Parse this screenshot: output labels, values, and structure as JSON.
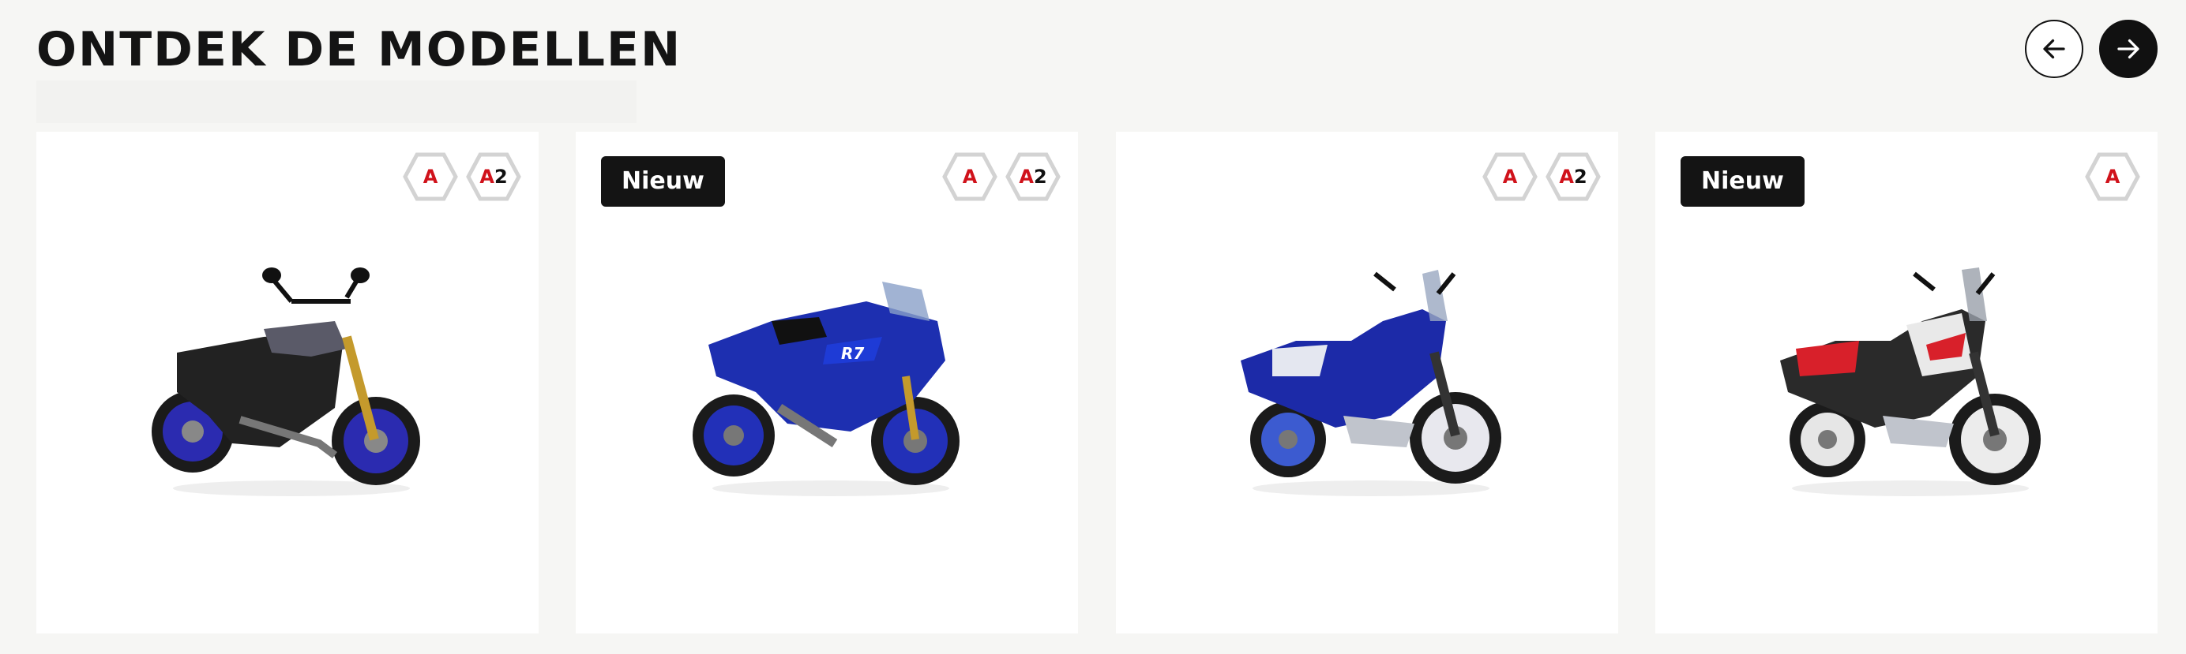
{
  "header": {
    "title": "ONTDEK DE MODELLEN",
    "prev_icon": "arrow-left-icon",
    "next_icon": "arrow-right-icon"
  },
  "colors": {
    "background": "#f6f6f4",
    "card": "#ffffff",
    "badge": "#141414",
    "license_red": "#d0121b",
    "hex_border": "#d3d3d3"
  },
  "cards": [
    {
      "badge": "",
      "licenses": [
        {
          "letter": "A",
          "suffix": ""
        },
        {
          "letter": "A",
          "suffix": "2"
        }
      ],
      "image": "motorcycle-naked-blue-black"
    },
    {
      "badge": "Nieuw",
      "licenses": [
        {
          "letter": "A",
          "suffix": ""
        },
        {
          "letter": "A",
          "suffix": "2"
        }
      ],
      "image": "motorcycle-sport-blue"
    },
    {
      "badge": "",
      "licenses": [
        {
          "letter": "A",
          "suffix": ""
        },
        {
          "letter": "A",
          "suffix": "2"
        }
      ],
      "image": "motorcycle-adventure-blue"
    },
    {
      "badge": "Nieuw",
      "licenses": [
        {
          "letter": "A",
          "suffix": ""
        }
      ],
      "image": "motorcycle-adventure-red"
    }
  ]
}
